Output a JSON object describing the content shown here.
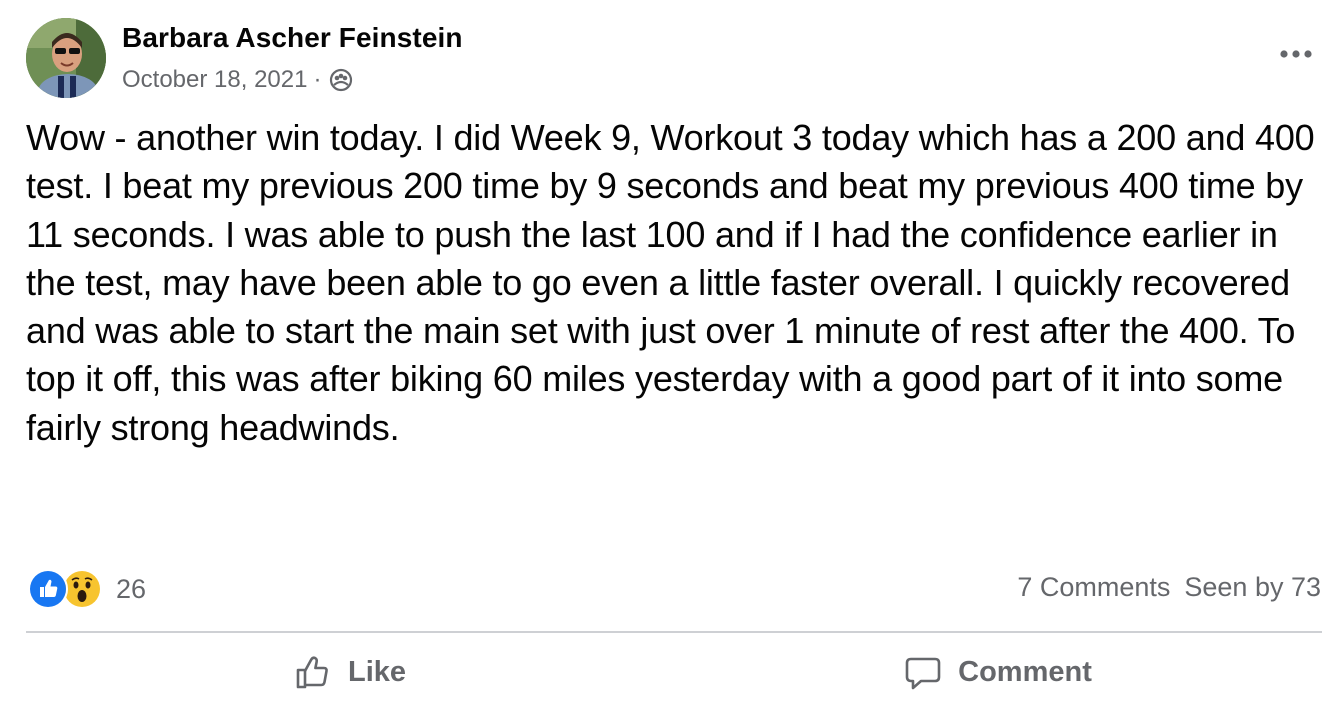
{
  "post": {
    "author": "Barbara Ascher Feinstein",
    "date": "October 18, 2021",
    "separator": "·",
    "audience_icon": "group-audience-icon",
    "more_icon": "more-options-icon",
    "text": "Wow - another win today. I did Week 9, Workout 3 today which has a 200 and 400 test. I beat my previous 200 time by 9 seconds and beat my previous 400 time by 11 seconds. I was able to push the last 100 and if I had the confidence earlier in the test, may have been able to go even a little faster overall. I quickly recovered and was able to start the main set with just over 1 minute of rest after the 400. To top it off, this was after biking 60 miles yesterday with a good part of it into some fairly strong headwinds."
  },
  "stats": {
    "reaction_icons": [
      "like-reaction-icon",
      "wow-reaction-icon"
    ],
    "reaction_count": "26",
    "comments": "7 Comments",
    "seen_by": "Seen by 73"
  },
  "actions": {
    "like_label": "Like",
    "comment_label": "Comment"
  },
  "colors": {
    "text_primary": "#050505",
    "text_secondary": "#65676b",
    "like_blue": "#1877f2",
    "wow_yellow": "#f7c42f",
    "divider": "#ced0d4"
  }
}
